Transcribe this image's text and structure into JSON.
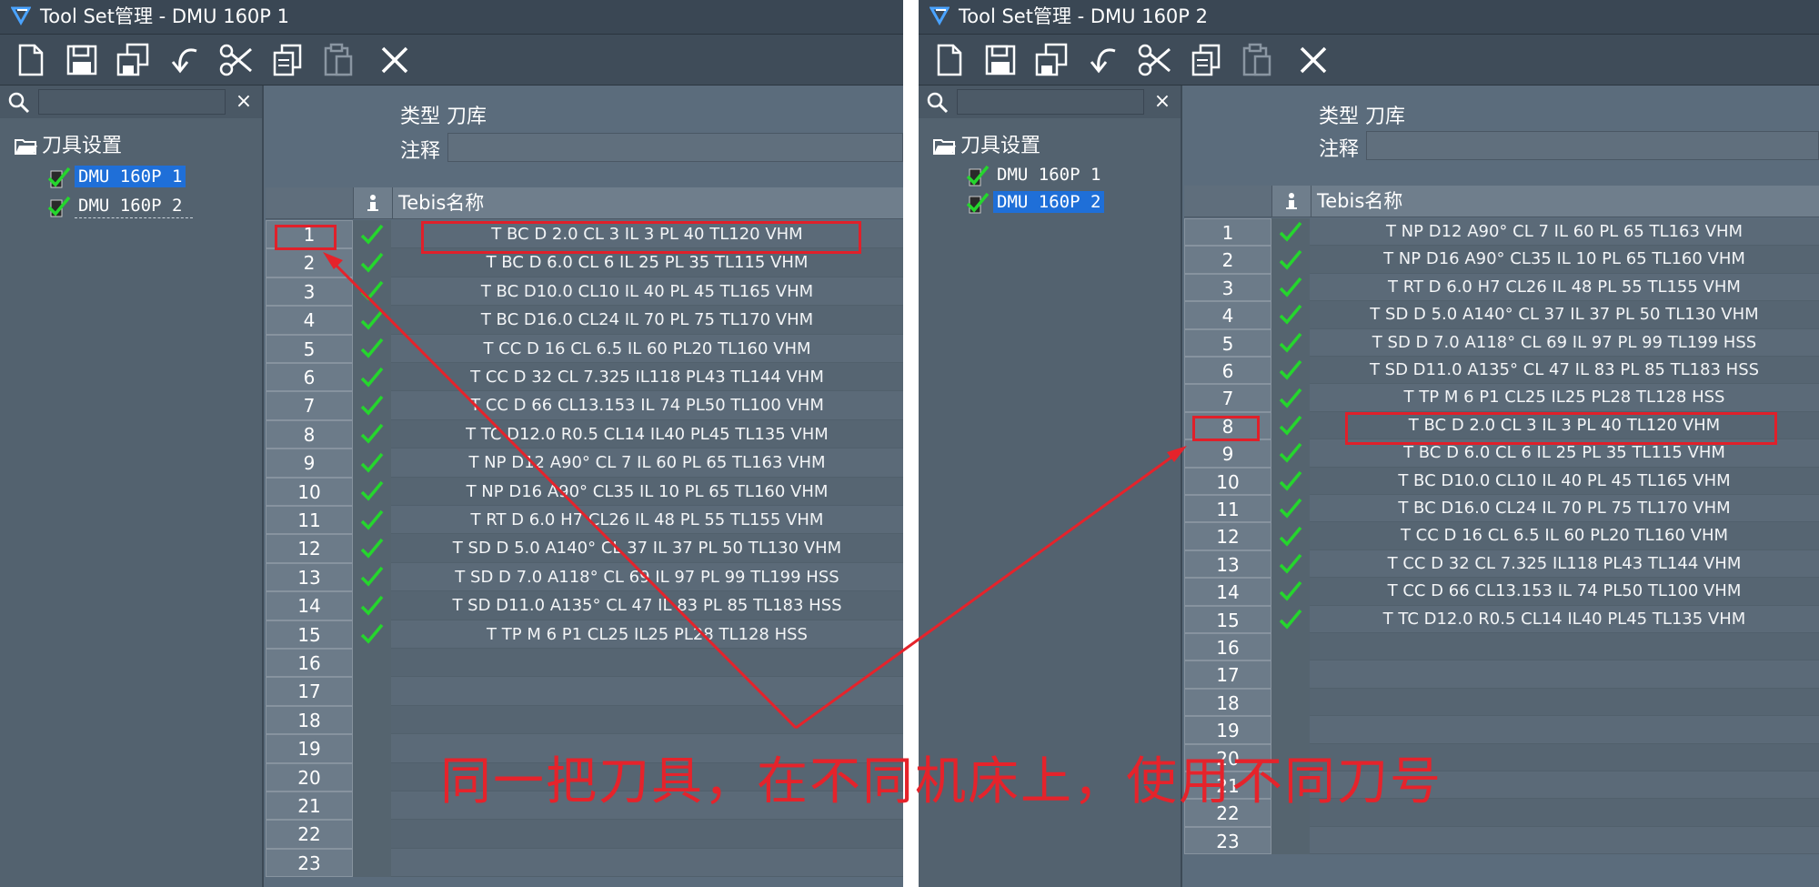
{
  "colors": {
    "accent": "#1f6fd8",
    "check": "#25d62d",
    "annotation": "#e5232b"
  },
  "windows": [
    {
      "title": "Tool Set管理 - DMU 160P 1",
      "toolbar": [
        "new-doc-icon",
        "save-icon",
        "save-all-icon",
        "undo-icon",
        "cut-icon",
        "copy-icon",
        "paste-icon",
        "delete-icon"
      ],
      "tree": {
        "root": "刀具设置",
        "items": [
          "DMU 160P 1",
          "DMU 160P 2"
        ],
        "selected": 0
      },
      "type_label": "类型 刀库",
      "note_label": "注释",
      "note_value": "",
      "column_header": "Tebis名称",
      "rows": [
        {
          "num": "1",
          "name": "T BC D 2.0 CL 3   IL  3   PL 40 TL120 VHM"
        },
        {
          "num": "2",
          "name": "T BC D 6.0 CL 6   IL 25   PL 35 TL115 VHM"
        },
        {
          "num": "3",
          "name": "T BC D10.0 CL10   IL 40   PL 45 TL165 VHM"
        },
        {
          "num": "4",
          "name": "T BC D16.0 CL24   IL 70   PL 75 TL170 VHM"
        },
        {
          "num": "5",
          "name": "T CC D 16 CL 6.5   IL 60 PL20 TL160 VHM"
        },
        {
          "num": "6",
          "name": "T CC D 32 CL 7.325 IL118 PL43 TL144 VHM"
        },
        {
          "num": "7",
          "name": "T CC D 66 CL13.153 IL 74 PL50 TL100 VHM"
        },
        {
          "num": "8",
          "name": "T TC D12.0 R0.5  CL14   IL40   PL45 TL135 VHM"
        },
        {
          "num": "9",
          "name": "T NP D12 A90° CL 7   IL 60 PL 65 TL163 VHM"
        },
        {
          "num": "10",
          "name": "T NP D16 A90° CL35   IL 10 PL 65 TL160 VHM"
        },
        {
          "num": "11",
          "name": "T RT D 6.0 H7 CL26 IL 48 PL 55 TL155 VHM"
        },
        {
          "num": "12",
          "name": "T SD D 5.0  A140° CL 37 IL 37 PL 50 TL130 VHM"
        },
        {
          "num": "13",
          "name": "T SD D 7.0  A118° CL 69 IL 97 PL 99 TL199 HSS"
        },
        {
          "num": "14",
          "name": "T SD D11.0  A135° CL 47 IL 83 PL 85 TL183 HSS"
        },
        {
          "num": "15",
          "name": "T TP M 6   P1    CL25   IL25   PL28 TL128 HSS"
        },
        {
          "num": "16",
          "name": ""
        },
        {
          "num": "17",
          "name": ""
        },
        {
          "num": "18",
          "name": ""
        },
        {
          "num": "19",
          "name": ""
        },
        {
          "num": "20",
          "name": ""
        },
        {
          "num": "21",
          "name": ""
        },
        {
          "num": "22",
          "name": ""
        },
        {
          "num": "23",
          "name": ""
        }
      ]
    },
    {
      "title": "Tool Set管理 - DMU 160P 2",
      "toolbar": [
        "new-doc-icon",
        "save-icon",
        "save-all-icon",
        "undo-icon",
        "cut-icon",
        "copy-icon",
        "paste-icon",
        "delete-icon"
      ],
      "tree": {
        "root": "刀具设置",
        "items": [
          "DMU 160P 1",
          "DMU 160P 2"
        ],
        "selected": 1
      },
      "type_label": "类型 刀库",
      "note_label": "注释",
      "note_value": "",
      "column_header": "Tebis名称",
      "rows": [
        {
          "num": "1",
          "name": "T NP D12 A90° CL 7   IL 60 PL 65 TL163 VHM"
        },
        {
          "num": "2",
          "name": "T NP D16 A90° CL35   IL 10 PL 65 TL160 VHM"
        },
        {
          "num": "3",
          "name": "T RT D 6.0 H7 CL26 IL 48 PL 55 TL155 VHM"
        },
        {
          "num": "4",
          "name": "T SD D 5.0  A140° CL 37 IL 37 PL 50 TL130 VHM"
        },
        {
          "num": "5",
          "name": "T SD D 7.0  A118° CL 69 IL 97 PL 99 TL199 HSS"
        },
        {
          "num": "6",
          "name": "T SD D11.0  A135° CL 47 IL 83 PL 85 TL183 HSS"
        },
        {
          "num": "7",
          "name": "T TP M 6   P1    CL25   IL25   PL28 TL128 HSS"
        },
        {
          "num": "8",
          "name": "T BC D 2.0 CL 3   IL  3   PL 40 TL120 VHM"
        },
        {
          "num": "9",
          "name": "T BC D 6.0 CL 6   IL 25   PL 35 TL115 VHM"
        },
        {
          "num": "10",
          "name": "T BC D10.0 CL10   IL 40   PL 45 TL165 VHM"
        },
        {
          "num": "11",
          "name": "T BC D16.0 CL24   IL 70   PL 75 TL170 VHM"
        },
        {
          "num": "12",
          "name": "T CC D 16 CL 6.5   IL 60 PL20 TL160 VHM"
        },
        {
          "num": "13",
          "name": "T CC D 32 CL 7.325 IL118 PL43 TL144 VHM"
        },
        {
          "num": "14",
          "name": "T CC D 66 CL13.153 IL 74 PL50 TL100 VHM"
        },
        {
          "num": "15",
          "name": "T TC D12.0 R0.5  CL14   IL40   PL45 TL135 VHM"
        },
        {
          "num": "16",
          "name": ""
        },
        {
          "num": "17",
          "name": ""
        },
        {
          "num": "18",
          "name": ""
        },
        {
          "num": "19",
          "name": ""
        },
        {
          "num": "20",
          "name": ""
        },
        {
          "num": "21",
          "name": ""
        },
        {
          "num": "22",
          "name": ""
        },
        {
          "num": "23",
          "name": ""
        }
      ]
    }
  ],
  "annotation": "同一把刀具，在不同机床上，使用不同刀号"
}
